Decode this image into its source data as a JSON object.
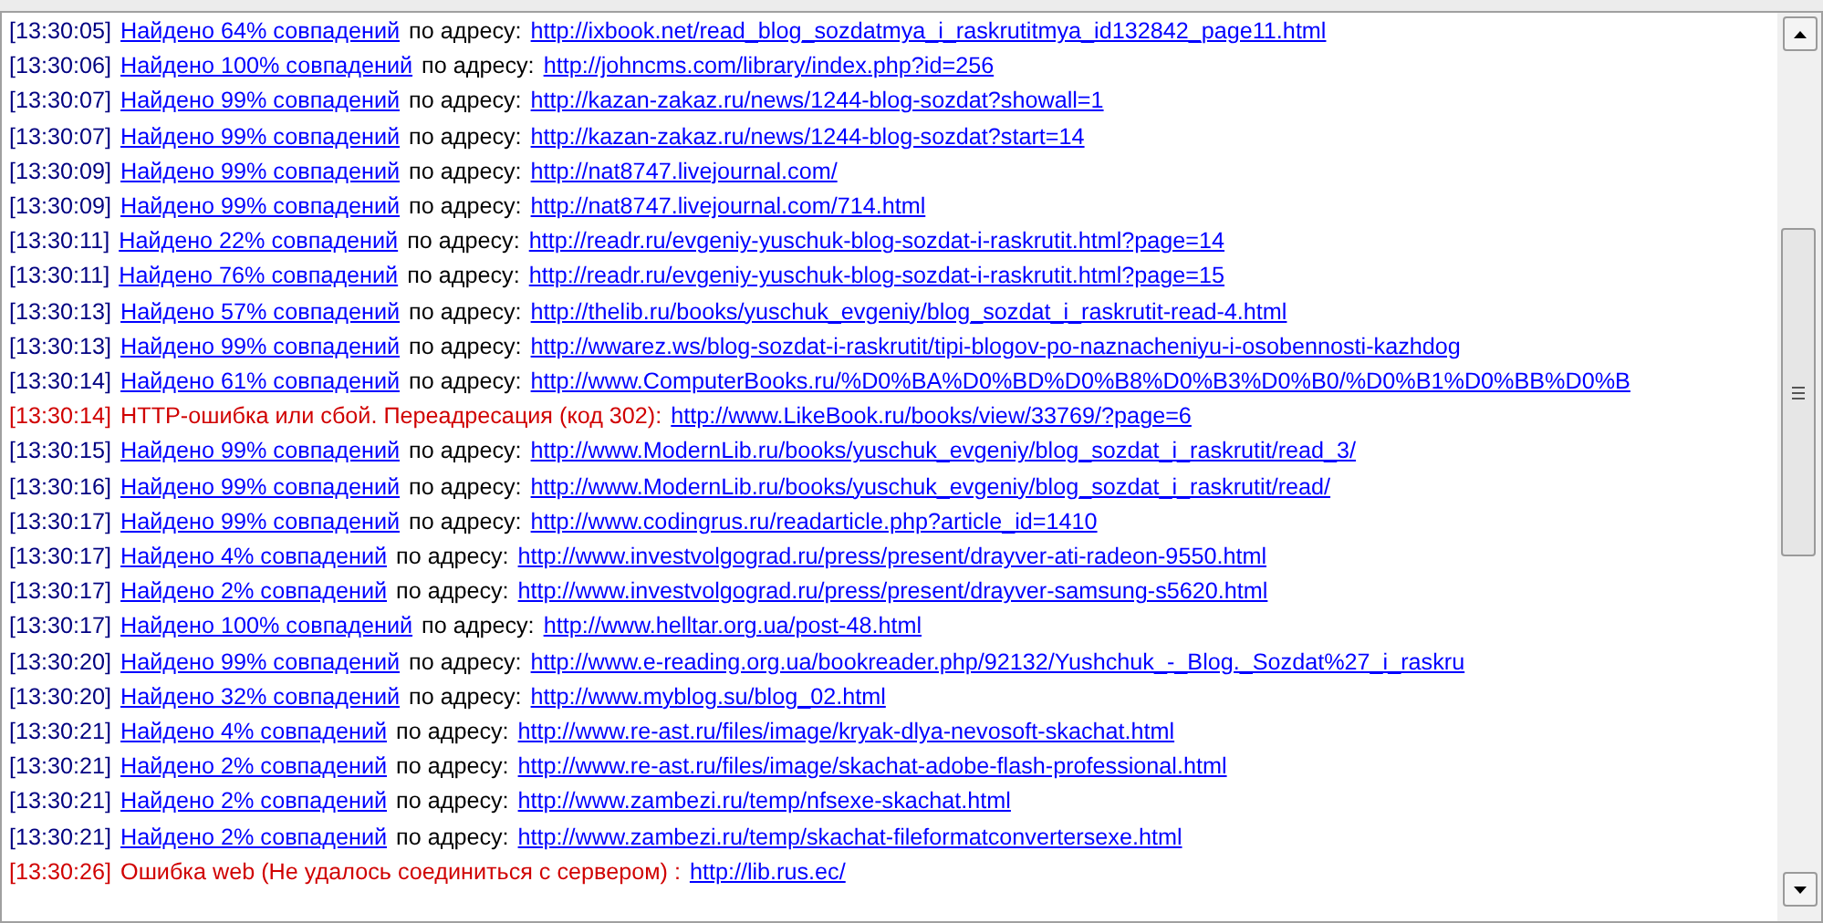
{
  "log": [
    {
      "kind": "match",
      "time": "[13:30:05]",
      "message": "Найдено 64% совпадений",
      "label": "по адресу:",
      "url": "http://ixbook.net/read_blog_sozdatmya_i_raskrutitmya_id132842_page11.html"
    },
    {
      "kind": "match",
      "time": "[13:30:06]",
      "message": "Найдено 100% совпадений",
      "label": "по адресу:",
      "url": "http://johncms.com/library/index.php?id=256"
    },
    {
      "kind": "match",
      "time": "[13:30:07]",
      "message": "Найдено 99% совпадений",
      "label": "по адресу:",
      "url": "http://kazan-zakaz.ru/news/1244-blog-sozdat?showall=1"
    },
    {
      "kind": "match",
      "time": "[13:30:07]",
      "message": "Найдено 99% совпадений",
      "label": "по адресу:",
      "url": "http://kazan-zakaz.ru/news/1244-blog-sozdat?start=14"
    },
    {
      "kind": "match",
      "time": "[13:30:09]",
      "message": "Найдено 99% совпадений",
      "label": "по адресу:",
      "url": "http://nat8747.livejournal.com/"
    },
    {
      "kind": "match",
      "time": "[13:30:09]",
      "message": "Найдено 99% совпадений",
      "label": "по адресу:",
      "url": "http://nat8747.livejournal.com/714.html"
    },
    {
      "kind": "match",
      "time": "[13:30:11]",
      "message": "Найдено 22% совпадений",
      "label": "по адресу:",
      "url": "http://readr.ru/evgeniy-yuschuk-blog-sozdat-i-raskrutit.html?page=14"
    },
    {
      "kind": "match",
      "time": "[13:30:11]",
      "message": "Найдено 76% совпадений",
      "label": "по адресу:",
      "url": "http://readr.ru/evgeniy-yuschuk-blog-sozdat-i-raskrutit.html?page=15"
    },
    {
      "kind": "match",
      "time": "[13:30:13]",
      "message": "Найдено 57% совпадений",
      "label": "по адресу:",
      "url": "http://thelib.ru/books/yuschuk_evgeniy/blog_sozdat_i_raskrutit-read-4.html"
    },
    {
      "kind": "match",
      "time": "[13:30:13]",
      "message": "Найдено 99% совпадений",
      "label": "по адресу:",
      "url": "http://wwarez.ws/blog-sozdat-i-raskrutit/tipi-blogov-po-naznacheniyu-i-osobennosti-kazhdog"
    },
    {
      "kind": "match",
      "time": "[13:30:14]",
      "message": "Найдено 61% совпадений",
      "label": "по адресу:",
      "url": "http://www.ComputerBooks.ru/%D0%BA%D0%BD%D0%B8%D0%B3%D0%B0/%D0%B1%D0%BB%D0%B"
    },
    {
      "kind": "error",
      "time": "[13:30:14]",
      "message": "HTTP-ошибка или сбой. Переадресация (код 302):",
      "url": "http://www.LikeBook.ru/books/view/33769/?page=6"
    },
    {
      "kind": "match",
      "time": "[13:30:15]",
      "message": "Найдено 99% совпадений",
      "label": "по адресу:",
      "url": "http://www.ModernLib.ru/books/yuschuk_evgeniy/blog_sozdat_i_raskrutit/read_3/"
    },
    {
      "kind": "match",
      "time": "[13:30:16]",
      "message": "Найдено 99% совпадений",
      "label": "по адресу:",
      "url": "http://www.ModernLib.ru/books/yuschuk_evgeniy/blog_sozdat_i_raskrutit/read/"
    },
    {
      "kind": "match",
      "time": "[13:30:17]",
      "message": "Найдено 99% совпадений",
      "label": "по адресу:",
      "url": "http://www.codingrus.ru/readarticle.php?article_id=1410"
    },
    {
      "kind": "match",
      "time": "[13:30:17]",
      "message": "Найдено 4% совпадений",
      "label": "по адресу:",
      "url": "http://www.investvolgograd.ru/press/present/drayver-ati-radeon-9550.html"
    },
    {
      "kind": "match",
      "time": "[13:30:17]",
      "message": "Найдено 2% совпадений",
      "label": "по адресу:",
      "url": "http://www.investvolgograd.ru/press/present/drayver-samsung-s5620.html"
    },
    {
      "kind": "match",
      "time": "[13:30:17]",
      "message": "Найдено 100% совпадений",
      "label": "по адресу:",
      "url": "http://www.helltar.org.ua/post-48.html"
    },
    {
      "kind": "match",
      "time": "[13:30:20]",
      "message": "Найдено 99% совпадений",
      "label": "по адресу:",
      "url": "http://www.e-reading.org.ua/bookreader.php/92132/Yushchuk_-_Blog._Sozdat%27_i_raskru"
    },
    {
      "kind": "match",
      "time": "[13:30:20]",
      "message": "Найдено 32% совпадений",
      "label": "по адресу:",
      "url": "http://www.myblog.su/blog_02.html"
    },
    {
      "kind": "match",
      "time": "[13:30:21]",
      "message": "Найдено 4% совпадений",
      "label": "по адресу:",
      "url": "http://www.re-ast.ru/files/image/kryak-dlya-nevosoft-skachat.html"
    },
    {
      "kind": "match",
      "time": "[13:30:21]",
      "message": "Найдено 2% совпадений",
      "label": "по адресу:",
      "url": "http://www.re-ast.ru/files/image/skachat-adobe-flash-professional.html"
    },
    {
      "kind": "match",
      "time": "[13:30:21]",
      "message": "Найдено 2% совпадений",
      "label": "по адресу:",
      "url": "http://www.zambezi.ru/temp/nfsexe-skachat.html"
    },
    {
      "kind": "match",
      "time": "[13:30:21]",
      "message": "Найдено 2% совпадений",
      "label": "по адресу:",
      "url": "http://www.zambezi.ru/temp/skachat-fileformatconvertersexe.html"
    },
    {
      "kind": "error",
      "time": "[13:30:26]",
      "message": "Ошибка web (Не удалось соединиться с сервером) :",
      "url": "http://lib.rus.ec/"
    }
  ]
}
